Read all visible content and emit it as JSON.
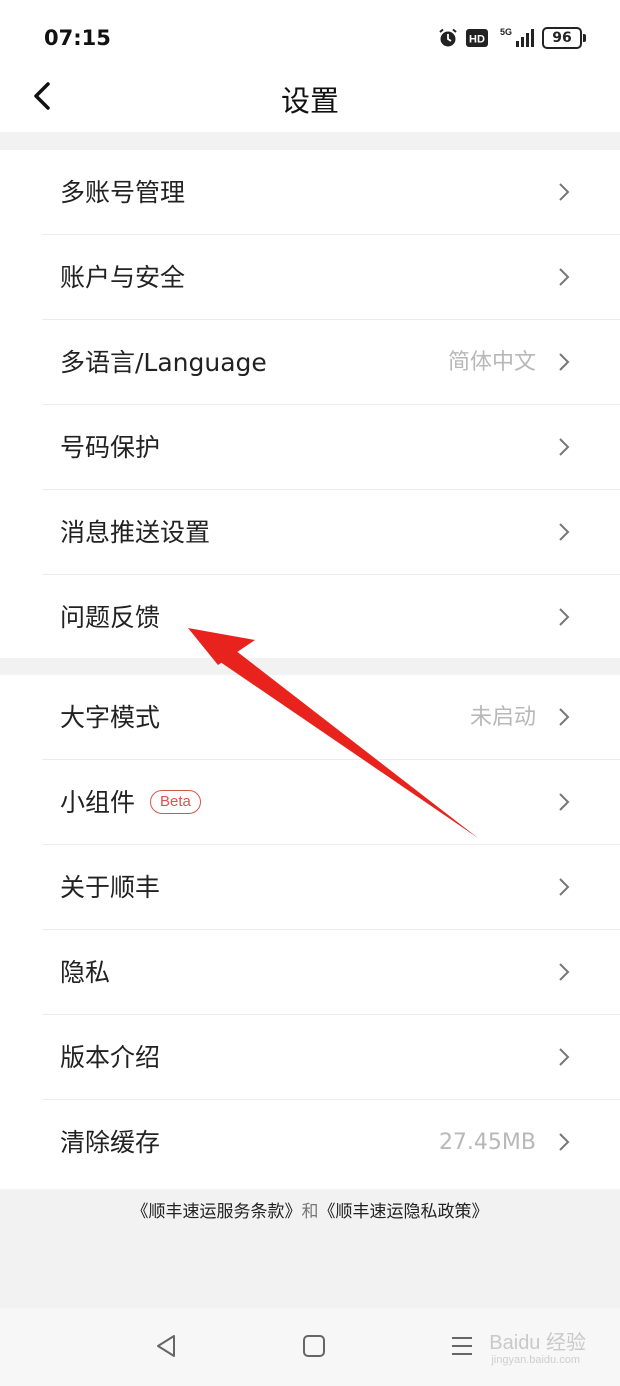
{
  "status_bar": {
    "time": "07:15",
    "hd_label": "HD",
    "network_label": "5G",
    "battery": "96"
  },
  "header": {
    "title": "设置"
  },
  "settings_group_1": [
    {
      "label": "多账号管理",
      "value": ""
    },
    {
      "label": "账户与安全",
      "value": ""
    },
    {
      "label": "多语言/Language",
      "value": "简体中文"
    },
    {
      "label": "号码保护",
      "value": ""
    },
    {
      "label": "消息推送设置",
      "value": ""
    },
    {
      "label": "问题反馈",
      "value": ""
    }
  ],
  "settings_group_2": [
    {
      "label": "大字模式",
      "value": "未启动"
    },
    {
      "label": "小组件",
      "value": "",
      "badge": "Beta"
    },
    {
      "label": "关于顺丰",
      "value": ""
    },
    {
      "label": "隐私",
      "value": ""
    },
    {
      "label": "版本介绍",
      "value": ""
    },
    {
      "label": "清除缓存",
      "value": "27.45MB"
    }
  ],
  "footer": {
    "terms_link": "《顺丰速运服务条款》",
    "connector": "和",
    "privacy_link": "《顺丰速运隐私政策》"
  },
  "watermark": {
    "text": "Baidu 经验",
    "sub": "jingyan.baidu.com"
  },
  "colors": {
    "accent_red": "#e8231d",
    "badge_red": "#d9534f",
    "secondary_text": "#b8b8b8"
  },
  "icons": {
    "back": "chevron-left-icon",
    "row_arrow": "chevron-right-icon",
    "nav_back": "triangle-back-icon",
    "nav_home": "square-home-icon",
    "nav_menu": "menu-lines-icon"
  }
}
